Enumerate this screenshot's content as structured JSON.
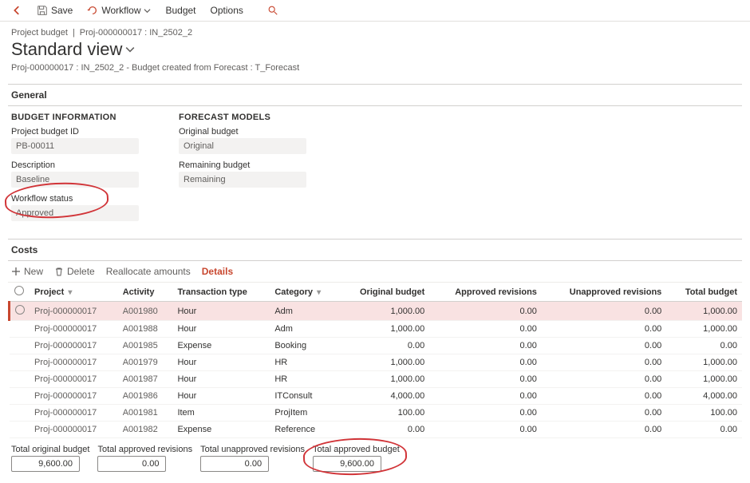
{
  "commandBar": {
    "save": "Save",
    "workflow": "Workflow",
    "budget": "Budget",
    "options": "Options"
  },
  "breadcrumb": {
    "area": "Project budget",
    "record": "Proj-000000017 : IN_2502_2"
  },
  "viewTitle": "Standard view",
  "subtitle": "Proj-000000017 : IN_2502_2 - Budget created from Forecast : T_Forecast",
  "general": {
    "header": "General",
    "budgetInfoHeader": "BUDGET INFORMATION",
    "forecastHeader": "FORECAST MODELS",
    "projectBudgetIdLabel": "Project budget ID",
    "projectBudgetId": "PB-00011",
    "descriptionLabel": "Description",
    "description": "Baseline",
    "workflowStatusLabel": "Workflow status",
    "workflowStatus": "Approved",
    "originalBudgetLabel": "Original budget",
    "originalBudget": "Original",
    "remainingBudgetLabel": "Remaining budget",
    "remainingBudget": "Remaining"
  },
  "costs": {
    "header": "Costs",
    "newBtn": "New",
    "deleteBtn": "Delete",
    "reallocBtn": "Reallocate amounts",
    "detailsBtn": "Details",
    "columns": {
      "project": "Project",
      "activity": "Activity",
      "txType": "Transaction type",
      "category": "Category",
      "origBudget": "Original budget",
      "apprRev": "Approved revisions",
      "unapprRev": "Unapproved revisions",
      "totalBudget": "Total budget"
    },
    "rows": [
      {
        "project": "Proj-000000017",
        "activity": "A001980",
        "txType": "Hour",
        "category": "Adm",
        "orig": "1,000.00",
        "appr": "0.00",
        "unappr": "0.00",
        "total": "1,000.00",
        "selected": true
      },
      {
        "project": "Proj-000000017",
        "activity": "A001988",
        "txType": "Hour",
        "category": "Adm",
        "orig": "1,000.00",
        "appr": "0.00",
        "unappr": "0.00",
        "total": "1,000.00"
      },
      {
        "project": "Proj-000000017",
        "activity": "A001985",
        "txType": "Expense",
        "category": "Booking",
        "orig": "0.00",
        "appr": "0.00",
        "unappr": "0.00",
        "total": "0.00"
      },
      {
        "project": "Proj-000000017",
        "activity": "A001979",
        "txType": "Hour",
        "category": "HR",
        "orig": "1,000.00",
        "appr": "0.00",
        "unappr": "0.00",
        "total": "1,000.00"
      },
      {
        "project": "Proj-000000017",
        "activity": "A001987",
        "txType": "Hour",
        "category": "HR",
        "orig": "1,000.00",
        "appr": "0.00",
        "unappr": "0.00",
        "total": "1,000.00"
      },
      {
        "project": "Proj-000000017",
        "activity": "A001986",
        "txType": "Hour",
        "category": "ITConsult",
        "orig": "4,000.00",
        "appr": "0.00",
        "unappr": "0.00",
        "total": "4,000.00"
      },
      {
        "project": "Proj-000000017",
        "activity": "A001981",
        "txType": "Item",
        "category": "ProjItem",
        "orig": "100.00",
        "appr": "0.00",
        "unappr": "0.00",
        "total": "100.00"
      },
      {
        "project": "Proj-000000017",
        "activity": "A001982",
        "txType": "Expense",
        "category": "Reference",
        "orig": "0.00",
        "appr": "0.00",
        "unappr": "0.00",
        "total": "0.00"
      }
    ],
    "totals": {
      "origLabel": "Total original budget",
      "orig": "9,600.00",
      "apprLabel": "Total approved revisions",
      "appr": "0.00",
      "unapprLabel": "Total unapproved revisions",
      "unappr": "0.00",
      "approvedLabel": "Total approved budget",
      "approved": "9,600.00"
    }
  }
}
